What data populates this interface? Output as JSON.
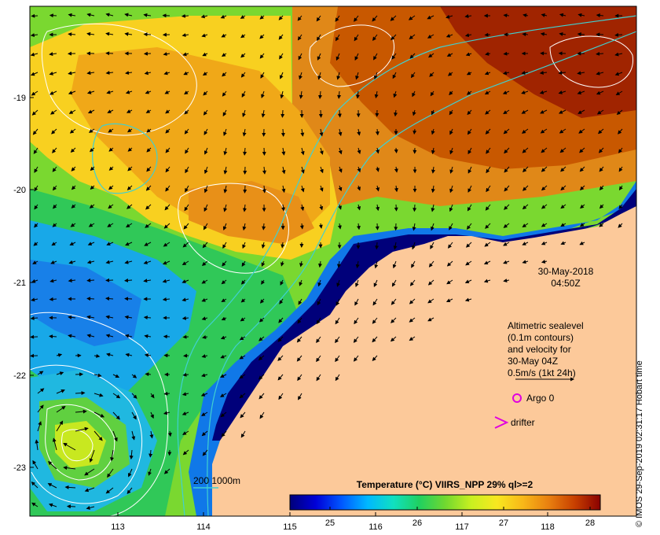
{
  "map": {
    "date": "30-May-2018",
    "time": "04:50Z",
    "lon_ticks": [
      "113",
      "114",
      "115",
      "116",
      "117",
      "118"
    ],
    "lat_ticks": [
      "-19",
      "-20",
      "-21",
      "-22",
      "-23"
    ]
  },
  "legend": {
    "altimetry_lines": [
      "Altimetric sealevel",
      "(0.1m contours)",
      "and velocity for",
      "30-May 04Z",
      "0.5m/s (1kt 24h)"
    ],
    "argo_label": "Argo 0",
    "drifter_label": "drifter",
    "bathymetry_label": "200  1000m",
    "colorbar_title": "Temperature (°C) VIIRS_NPP 29% ql>=2",
    "colorbar_ticks": [
      "25",
      "26",
      "27",
      "28"
    ]
  },
  "credit": "© IMOS 29-Sep-2019 02:31:17 Hobart time",
  "colors": {
    "land": "#fcc99a",
    "argo": "#e000e0",
    "bathymetry": "#40d0d0",
    "colorbar": [
      "#00007a",
      "#0000d8",
      "#0058ff",
      "#00b8ff",
      "#10e0c0",
      "#20d060",
      "#70d830",
      "#c8f020",
      "#f8e820",
      "#f8b818",
      "#e88010",
      "#c84000",
      "#8a0000"
    ]
  }
}
